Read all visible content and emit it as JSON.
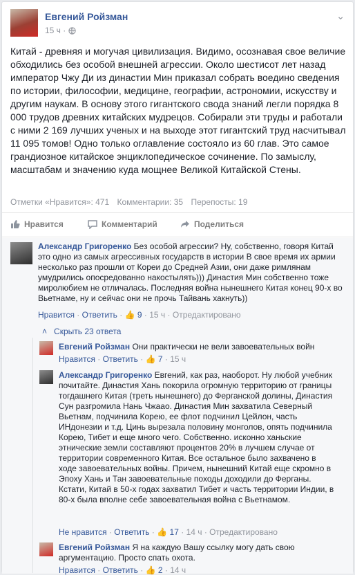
{
  "post": {
    "author": "Евгений Ройзман",
    "time": "15 ч",
    "text": "Китай - древняя и могучая цивилизация. Видимо, осознавая свое величие обходились без особой внешней агрессии. Около шестисот лет назад император Чжу Ди из династии Мин приказал собрать воедино сведения по истории, философии, медицине, географии, астрономии, искусству и другим наукам. В основу этого гигантского свода знаний легли порядка 8 000 трудов древних китайских мудрецов. Собирали эти труды и работали с ними 2 169 лучших ученых и на выходе этот гигантский труд насчитывал 11 095 томов! Одно только оглавление состояло из 60 глав. Это самое грандиозное китайское энциклопедическое сочинение. По замыслу, масштабам и значению куда мощнее Великой Китайской Стены.",
    "stats": {
      "likes": "Отметки «Нравится»: 471",
      "comments": "Комментарии: 35",
      "shares": "Перепосты: 19"
    }
  },
  "actions": {
    "like": "Нравится",
    "comment": "Комментарий",
    "share": "Поделиться"
  },
  "comments": [
    {
      "author": "Александр Григоренко",
      "text": "Без особой агрессии? Ну, собственно, говоря Китай это одно из самых агрессивных государств в истории В свое время их армии несколько раз прошли от Кореи до Средней Азии, они даже римлянам умудрились опосредованно накостылять))) Династия Мин собственно тоже миролюбием не отличалась. Последняя война нынешнего Китая конец 90-х во Вьетнаме, ну и сейчас они не прочь Тайвань хакнуть))",
      "like": "Нравится",
      "reply": "Ответить",
      "likes": "9",
      "time": "15 ч",
      "status": "Отредактировано"
    }
  ],
  "hide_replies": "Скрыть 23 ответа",
  "replies": [
    {
      "author": "Евгений Ройзман",
      "text": "Они практически не вели завоевательных войн",
      "like": "Нравится",
      "reply": "Ответить",
      "likes": "7",
      "time": "15 ч"
    },
    {
      "author": "Александр Григоренко",
      "text": "Евгений, как раз, наоборот. Ну любой учебник почитайте. Династия Хань покорила огромную территорию от границы тогдашнего Китая (треть нынешнего) до Ферганской долины, Династия Сун разгромила Нань Чжаао. Династия Мин захватила Северный Вьетнам, подчинила Корею, ее флот подчинил Цейлон, часть ИНдонезии и т.д. Цинь вырезала половину монголов, опять подчинила Корею, Тибет и еще много чего. Собственно. исконно ханьские этнические земли составляют процентов 20% в лучшем случае от территории современного Китая. Все остальное было захвачено в ходе завоевательных войны. Причем, нынешний Китай еще скромно в Эпоху Хань и Тан завоевательные походы доходили до Ферганы. Кстати, Китай в 50-х годах захватил Тибет и часть территории Индии, в 80-х была вполне себе завоевательная война с Вьетнамом.",
      "like": "Не нравится",
      "reply": "Ответить",
      "likes": "17",
      "time": "14 ч",
      "status": "Отредактировано"
    },
    {
      "author": "Евгений Ройзман",
      "text": "Я на каждую Вашу ссылку могу дать свою аргументацию. Просто спать охота.",
      "like": "Нравится",
      "reply": "Ответить",
      "likes": "2",
      "time": "14 ч"
    }
  ],
  "colors": {
    "link": "#365899",
    "meta": "#90949c",
    "like_blue": "#5890ff"
  }
}
